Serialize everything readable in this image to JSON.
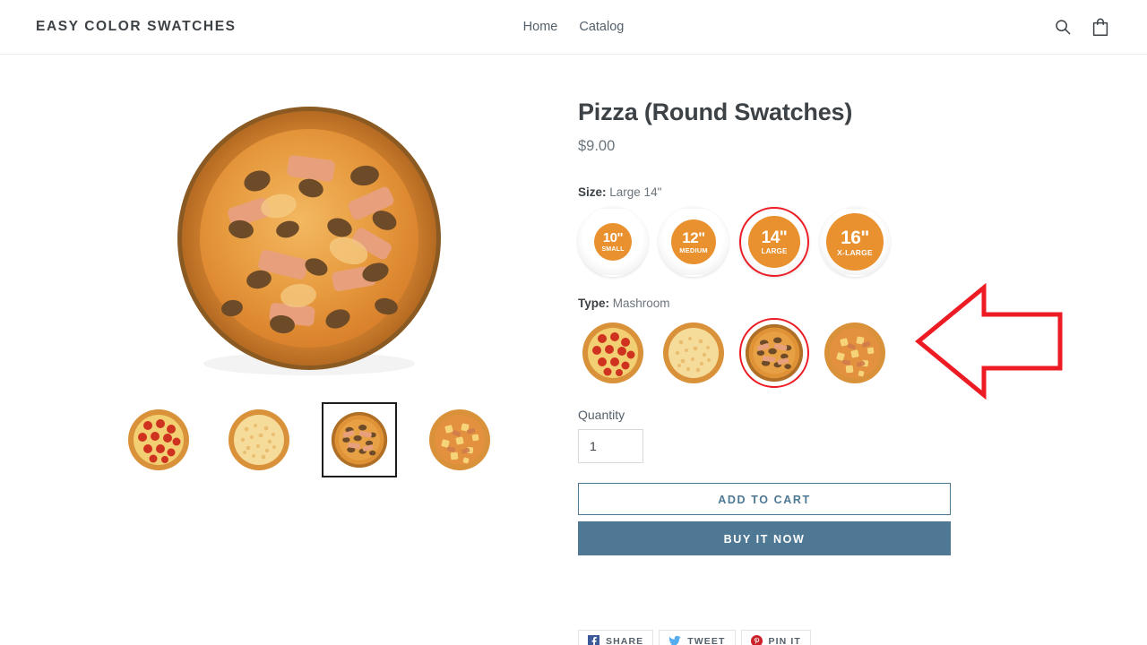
{
  "header": {
    "brand": "EASY COLOR SWATCHES",
    "nav": [
      {
        "label": "Home",
        "name": "nav-link-home"
      },
      {
        "label": "Catalog",
        "name": "nav-link-catalog"
      }
    ],
    "actions": [
      {
        "icon": "search-icon",
        "label": "Search"
      },
      {
        "icon": "shopping-bag-icon",
        "label": "Cart"
      }
    ]
  },
  "product": {
    "title": "Pizza (Round Swatches)",
    "price": "$9.00"
  },
  "size_option": {
    "label": "Size:",
    "selected_value": "Large 14\"",
    "swatches": [
      {
        "inches": "10\"",
        "name": "SMALL",
        "selected": false,
        "disc": 42,
        "fs_in": 15,
        "fs_nm": 7
      },
      {
        "inches": "12\"",
        "name": "MEDIUM",
        "selected": false,
        "disc": 50,
        "fs_in": 17,
        "fs_nm": 7.5
      },
      {
        "inches": "14\"",
        "name": "LARGE",
        "selected": true,
        "disc": 58,
        "fs_in": 19,
        "fs_nm": 8
      },
      {
        "inches": "16\"",
        "name": "X-LARGE",
        "selected": false,
        "disc": 64,
        "fs_in": 21,
        "fs_nm": 8.5
      }
    ]
  },
  "type_option": {
    "label": "Type:",
    "selected_value": "Mashroom",
    "swatches": [
      {
        "name": "Pepperoni",
        "selected": false,
        "kind": "pepperoni"
      },
      {
        "name": "Cheese",
        "selected": false,
        "kind": "cheese"
      },
      {
        "name": "Mashroom",
        "selected": true,
        "kind": "mushroom"
      },
      {
        "name": "Hawaiian",
        "selected": false,
        "kind": "hawaiian"
      }
    ]
  },
  "quantity": {
    "label": "Quantity",
    "value": "1"
  },
  "buttons": {
    "add_to_cart": "ADD TO CART",
    "buy_it_now": "BUY IT NOW"
  },
  "share": [
    {
      "label": "SHARE",
      "icon": "facebook-icon",
      "color": "#3b5998"
    },
    {
      "label": "TWEET",
      "icon": "twitter-icon",
      "color": "#55acee"
    },
    {
      "label": "PIN IT",
      "icon": "pinterest-icon",
      "color": "#cb2027"
    }
  ],
  "gallery": {
    "hero": {
      "kind": "mushroom",
      "alt": "Mushroom and ham pizza"
    },
    "thumbs": [
      {
        "kind": "pepperoni",
        "selected": false
      },
      {
        "kind": "cheese",
        "selected": false
      },
      {
        "kind": "mushroom",
        "selected": true
      },
      {
        "kind": "hawaiian",
        "selected": false
      }
    ]
  },
  "annotation": {
    "shape": "left-arrow",
    "color": "#ed1c24"
  },
  "colors": {
    "orange": "#e8912e",
    "red_ring": "#ed1c24",
    "slate_blue": "#4f7894",
    "text_dark": "#3d4246",
    "text_muted": "#6b747c"
  }
}
